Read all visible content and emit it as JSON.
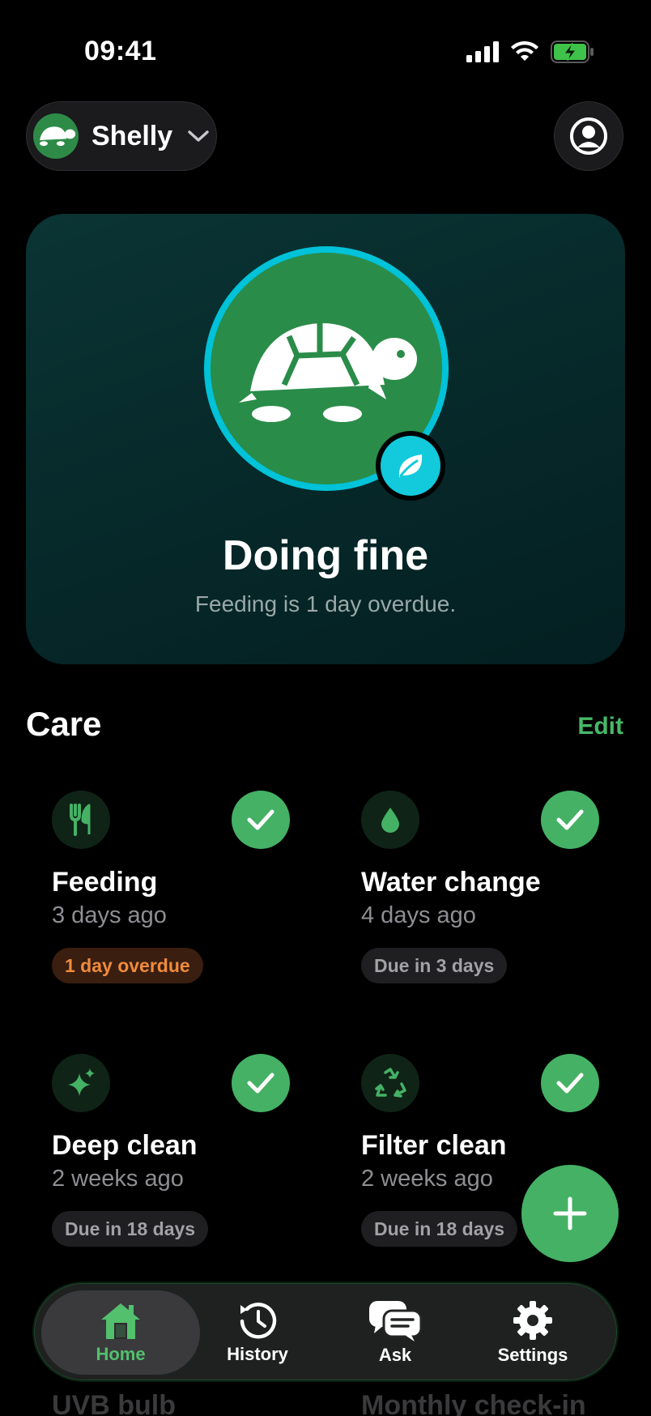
{
  "status_bar": {
    "time": "09:41"
  },
  "header": {
    "pet_name": "Shelly"
  },
  "hero": {
    "title": "Doing fine",
    "subtitle": "Feeding is 1 day overdue."
  },
  "care": {
    "title": "Care",
    "edit_label": "Edit",
    "tasks": [
      {
        "title": "Feeding",
        "last_done": "3 days ago",
        "status": "1 day overdue",
        "icon": "fork-knife-icon"
      },
      {
        "title": "Water change",
        "last_done": "4 days ago",
        "status": "Due in 3 days",
        "icon": "water-drop-icon"
      },
      {
        "title": "Deep clean",
        "last_done": "2 weeks ago",
        "status": "Due in 18 days",
        "icon": "sparkle-icon"
      },
      {
        "title": "Filter clean",
        "last_done": "2 weeks ago",
        "status": "Due in 18 days",
        "icon": "recycle-icon"
      }
    ],
    "peek_items": [
      "UVB bulb",
      "Monthly check-in"
    ]
  },
  "tabbar": {
    "tabs": [
      {
        "label": "Home",
        "icon": "home-icon",
        "active": true
      },
      {
        "label": "History",
        "icon": "history-icon",
        "active": false
      },
      {
        "label": "Ask",
        "icon": "chat-bubbles-icon",
        "active": false
      },
      {
        "label": "Settings",
        "icon": "gear-icon",
        "active": false
      }
    ]
  },
  "colors": {
    "accent": "#45b165",
    "ring": "#00c2d8",
    "overdue": "#f08b3c"
  }
}
